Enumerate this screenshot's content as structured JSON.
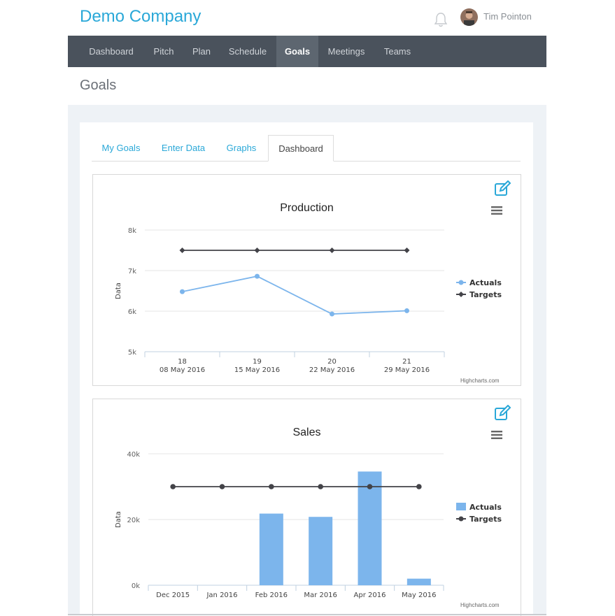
{
  "header": {
    "brand": "Demo Company",
    "user_name": "Tim Pointon",
    "icons": [
      "bell-icon",
      "avatar"
    ]
  },
  "nav": {
    "items": [
      {
        "label": "Dashboard",
        "active": false
      },
      {
        "label": "Pitch",
        "active": false
      },
      {
        "label": "Plan",
        "active": false
      },
      {
        "label": "Schedule",
        "active": false
      },
      {
        "label": "Goals",
        "active": true
      },
      {
        "label": "Meetings",
        "active": false
      },
      {
        "label": "Teams",
        "active": false
      }
    ]
  },
  "page": {
    "title": "Goals"
  },
  "tabs": [
    {
      "label": "My Goals",
      "active": false
    },
    {
      "label": "Enter Data",
      "active": false
    },
    {
      "label": "Graphs",
      "active": false
    },
    {
      "label": "Dashboard",
      "active": true
    }
  ],
  "colors": {
    "brand": "#2aa8d8",
    "nav_bg": "#4a525c",
    "actuals": "#7cb5ec",
    "targets": "#434348"
  },
  "chart_data": [
    {
      "type": "line",
      "title": "Production",
      "ylabel": "Data",
      "ylim": [
        5000,
        8000
      ],
      "yticks": [
        "5k",
        "6k",
        "7k",
        "8k"
      ],
      "categories": [
        {
          "line1": "18",
          "line2": "08 May 2016"
        },
        {
          "line1": "19",
          "line2": "15 May 2016"
        },
        {
          "line1": "20",
          "line2": "22 May 2016"
        },
        {
          "line1": "21",
          "line2": "29 May 2016"
        }
      ],
      "series": [
        {
          "name": "Actuals",
          "values": [
            6480,
            6860,
            5930,
            6010
          ]
        },
        {
          "name": "Targets",
          "values": [
            7500,
            7500,
            7500,
            7500
          ]
        }
      ],
      "legend": "right",
      "credit": "Highcharts.com"
    },
    {
      "type": "bar",
      "title": "Sales",
      "ylabel": "Data",
      "ylim": [
        0,
        40000
      ],
      "yticks": [
        "0k",
        "20k",
        "40k"
      ],
      "categories": [
        "Dec 2015",
        "Jan 2016",
        "Feb 2016",
        "Mar 2016",
        "Apr 2016",
        "May 2016"
      ],
      "series": [
        {
          "name": "Actuals",
          "values": [
            0,
            0,
            21800,
            20800,
            34600,
            2000
          ]
        },
        {
          "name": "Targets",
          "values": [
            30000,
            30000,
            30000,
            30000,
            30000,
            30000
          ]
        }
      ],
      "legend": "right",
      "credit": "Highcharts.com"
    }
  ]
}
